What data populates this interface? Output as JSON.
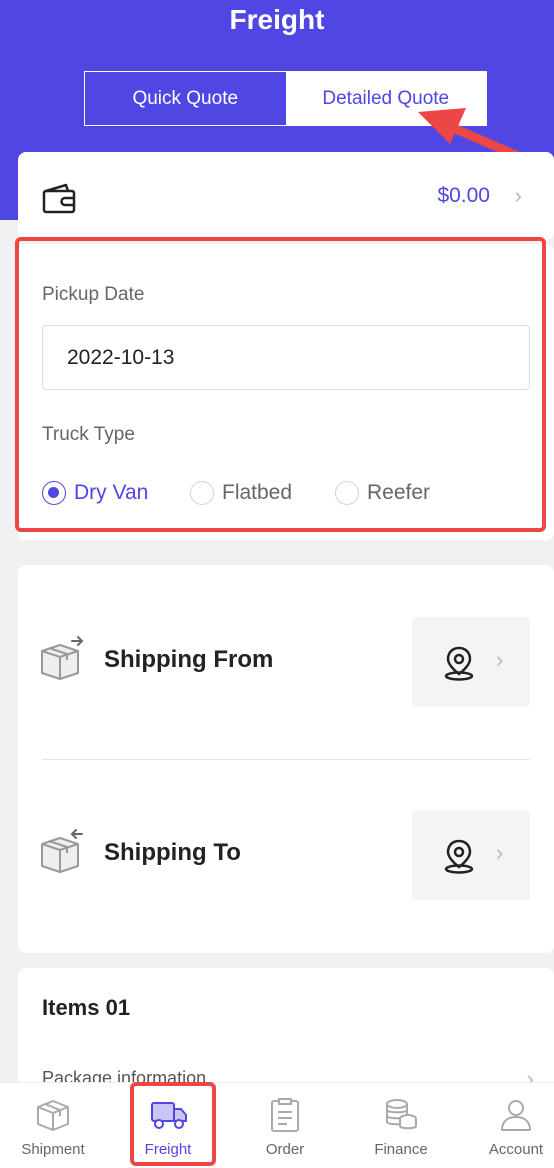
{
  "header": {
    "title": "Freight"
  },
  "quote_tabs": [
    {
      "label": "Quick Quote",
      "selected": false
    },
    {
      "label": "Detailed Quote",
      "selected": true
    }
  ],
  "wallet": {
    "icon": "wallet-icon",
    "amount": "$0.00"
  },
  "form": {
    "pickup_label": "Pickup Date",
    "pickup_value": "2022-10-13",
    "truck_label": "Truck Type",
    "truck_options": [
      {
        "label": "Dry Van",
        "selected": true
      },
      {
        "label": "Flatbed",
        "selected": false
      },
      {
        "label": "Reefer",
        "selected": false
      }
    ]
  },
  "shipping": {
    "from_label": "Shipping From",
    "to_label": "Shipping To"
  },
  "items": {
    "title": "Items 01",
    "package_info": "Package information"
  },
  "tabbar": [
    {
      "label": "Shipment",
      "icon": "box-icon"
    },
    {
      "label": "Freight",
      "icon": "truck-icon",
      "active": true
    },
    {
      "label": "Order",
      "icon": "clipboard-icon"
    },
    {
      "label": "Finance",
      "icon": "coins-icon"
    },
    {
      "label": "Account",
      "icon": "user-icon"
    }
  ],
  "colors": {
    "brand": "#5046e4",
    "highlight": "#ec4646"
  }
}
